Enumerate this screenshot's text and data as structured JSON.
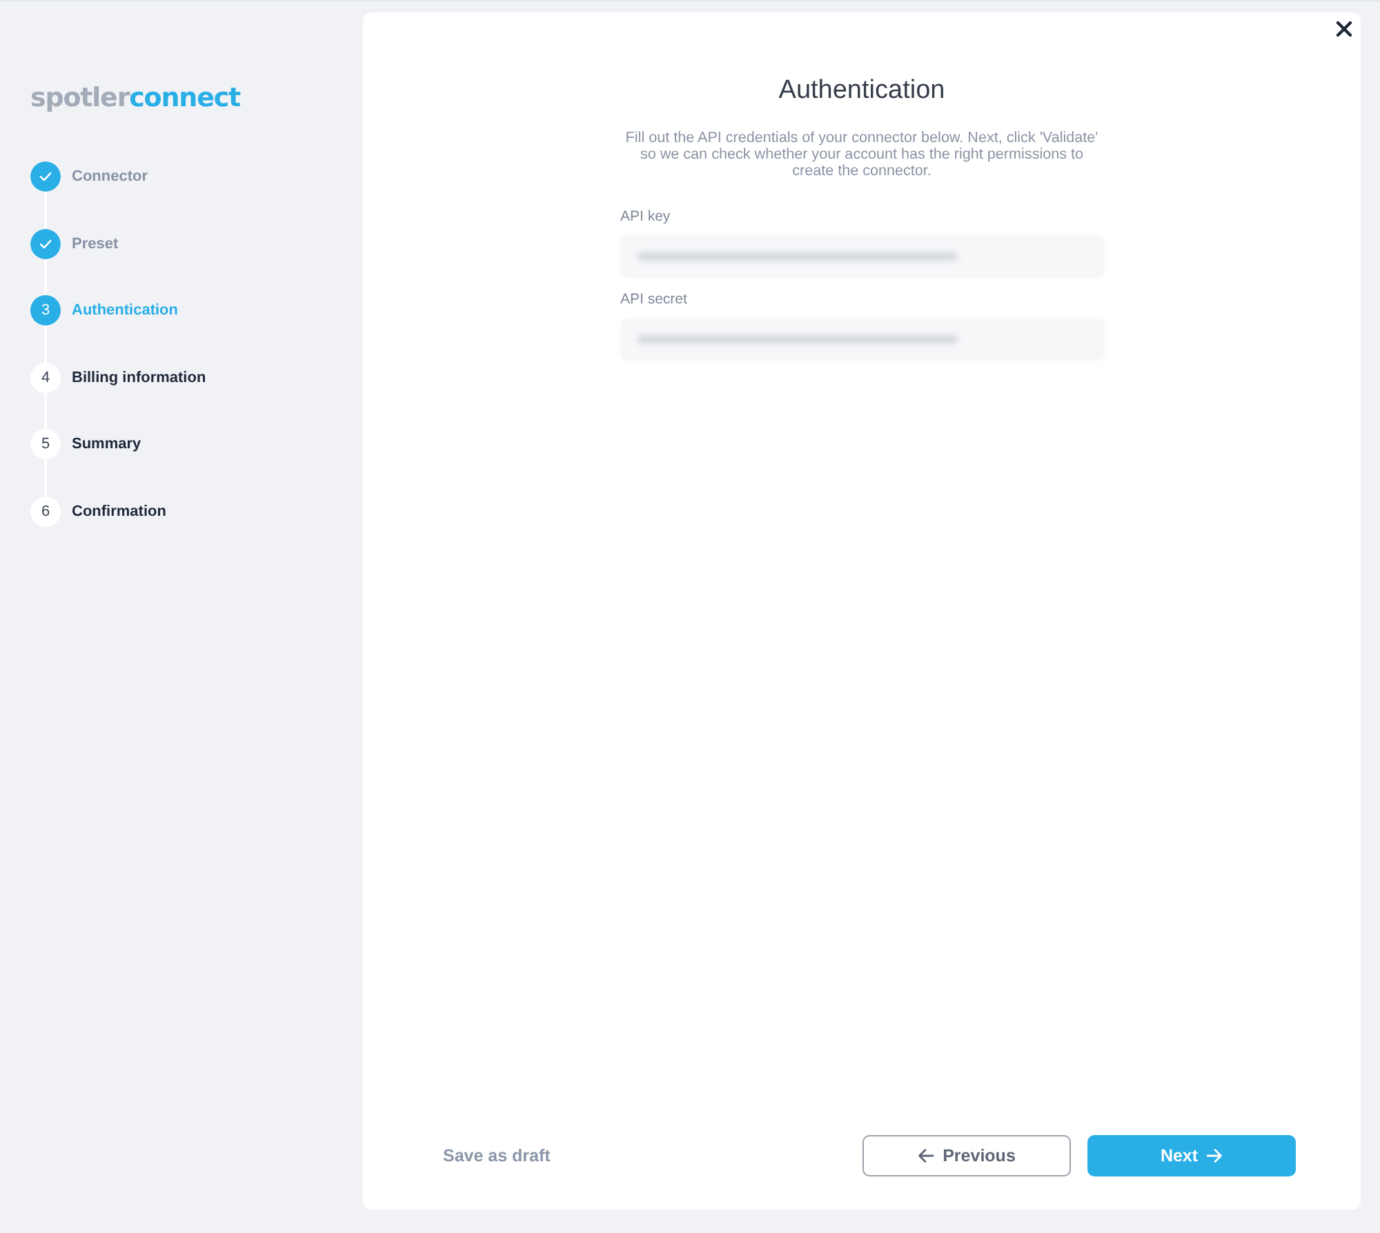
{
  "logo": {
    "parts": [
      {
        "text": "spotler",
        "kind": "plain"
      },
      {
        "text": "connect",
        "kind": "accent"
      }
    ]
  },
  "steps": [
    {
      "label": "Connector",
      "completed": true,
      "selected": false
    },
    {
      "label": "Preset",
      "completed": true,
      "selected": false
    },
    {
      "number": "3",
      "label": "Authentication",
      "completed": false,
      "selected": true
    },
    {
      "number": "4",
      "label": "Billing information",
      "completed": false,
      "selected": false
    },
    {
      "number": "5",
      "label": "Summary",
      "completed": false,
      "selected": false
    },
    {
      "number": "6",
      "label": "Confirmation",
      "completed": false,
      "selected": false
    }
  ],
  "panel": {
    "title": "Authentication",
    "description": "Fill out the API credentials of your connector below. Next, click 'Validate' so we can check whether your account has the right permissions to create the connector.",
    "fields": [
      {
        "label": "API key",
        "value_hidden": true
      },
      {
        "label": "API secret",
        "value_hidden": true
      }
    ]
  },
  "footer": {
    "save_draft": "Save as draft",
    "previous": "Previous",
    "next": "Next"
  }
}
